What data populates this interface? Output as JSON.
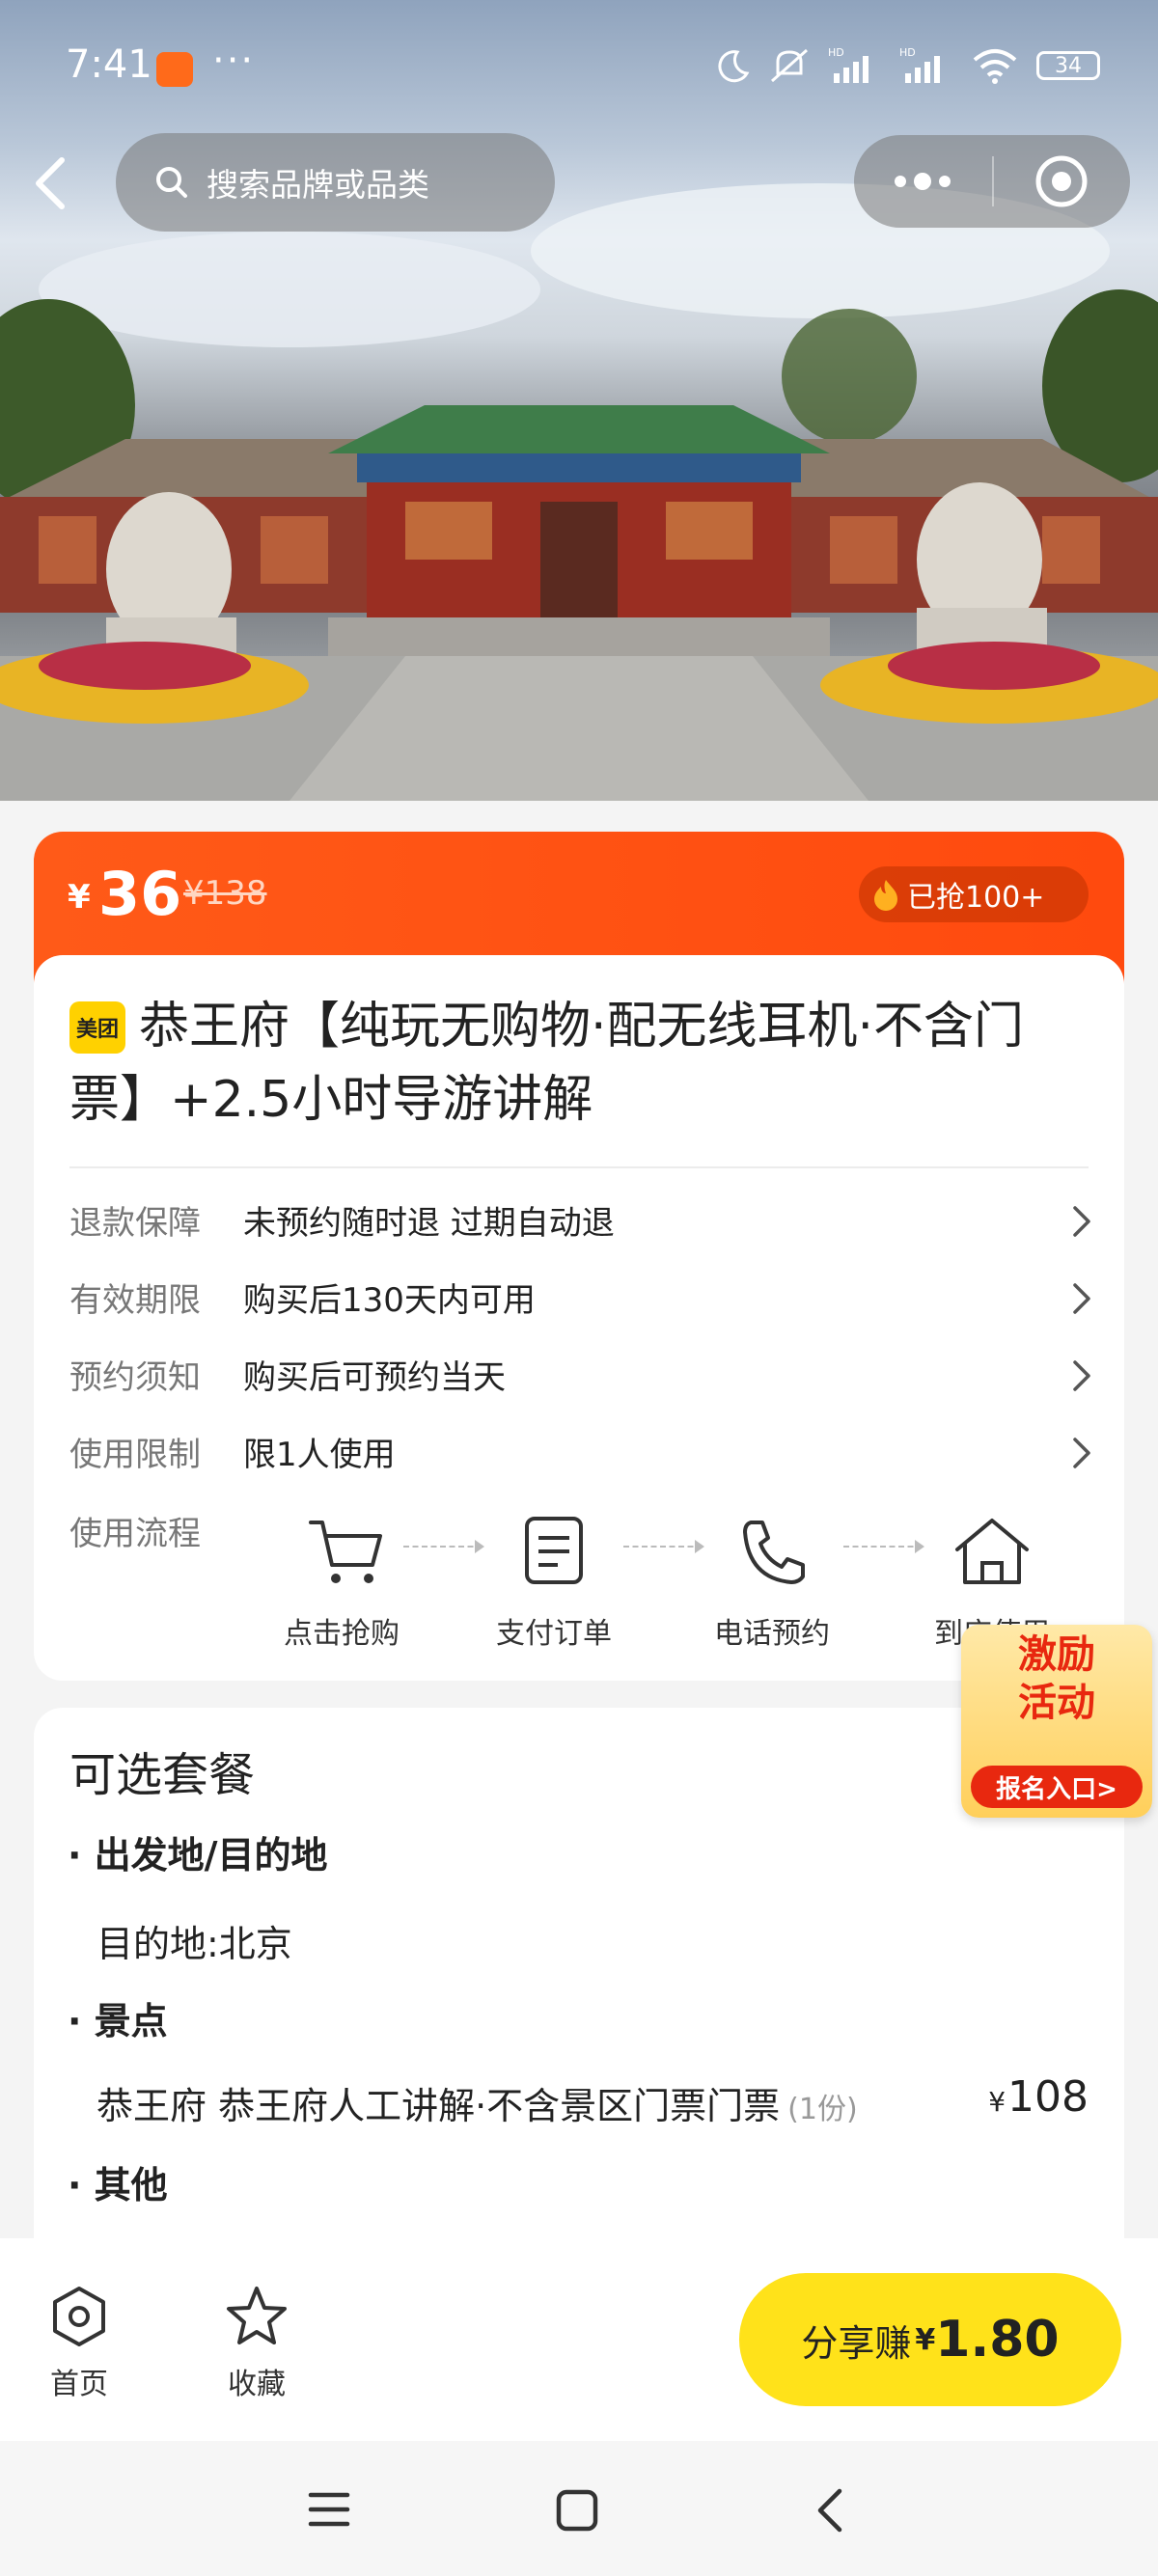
{
  "status_bar": {
    "time": "7:41",
    "dots": "···",
    "battery": "34"
  },
  "header": {
    "search_placeholder": "搜索品牌或品类"
  },
  "price": {
    "currency": "¥",
    "current": "36",
    "original": "¥138",
    "sold_badge": "已抢100+"
  },
  "product": {
    "brand_badge": "美团",
    "title": "恭王府【纯玩无购物·配无线耳机·不含门票】+2.5小时导游讲解",
    "info_rows": [
      {
        "label": "退款保障",
        "value": "未预约随时退 过期自动退"
      },
      {
        "label": "有效期限",
        "value": "购买后130天内可用"
      },
      {
        "label": "预约须知",
        "value": "购买后可预约当天"
      },
      {
        "label": "使用限制",
        "value": "限1人使用"
      }
    ],
    "flow_label": "使用流程",
    "flow_steps": [
      "点击抢购",
      "支付订单",
      "电话预约",
      "到店使用"
    ]
  },
  "promo": {
    "line1": "激励",
    "line2": "活动",
    "button": "报名入口>"
  },
  "package": {
    "title": "可选套餐",
    "sections": [
      {
        "heading": "出发地/目的地",
        "text": "目的地:北京"
      },
      {
        "heading": "景点",
        "text": "恭王府 恭王府人工讲解·不含景区门票门票",
        "qty": "(1份)",
        "price_currency": "¥",
        "price": "108"
      },
      {
        "heading": "其他"
      }
    ]
  },
  "bottom_bar": {
    "home_label": "首页",
    "favorite_label": "收藏",
    "share_label": "分享赚",
    "share_currency": "¥",
    "share_amount": "1.80"
  },
  "colors": {
    "accent_orange": "#ff5a18",
    "share_yellow": "#ffe21a",
    "brand_yellow": "#ffd100"
  }
}
